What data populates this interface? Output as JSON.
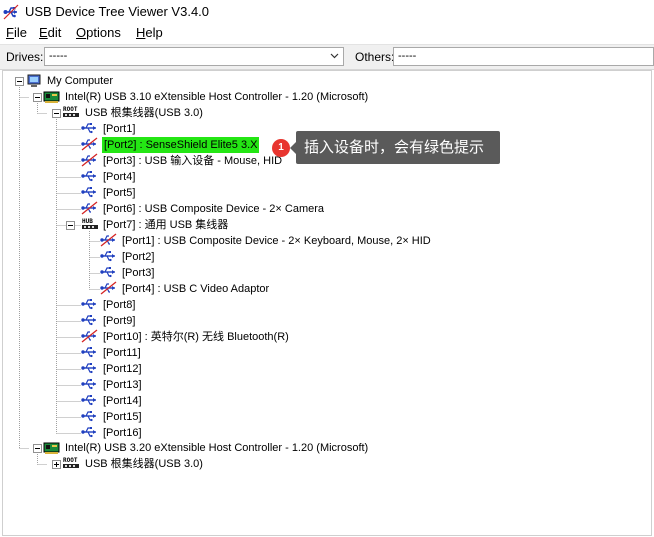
{
  "window": {
    "title": "USB Device Tree Viewer V3.4.0"
  },
  "menu": {
    "items": [
      {
        "key": "F",
        "rest": "ile"
      },
      {
        "key": "E",
        "rest": "dit"
      },
      {
        "key": "O",
        "rest": "ptions"
      },
      {
        "key": "H",
        "rest": "elp"
      }
    ]
  },
  "toolbar": {
    "drives_label": "Drives:",
    "drives_value": "-----",
    "others_label": "Others:",
    "others_value": "-----"
  },
  "tree": {
    "root": "My Computer",
    "controller1": "Intel(R) USB 3.10 eXtensible Host Controller - 1.20 (Microsoft)",
    "roothub1_badge": "ROOT",
    "roothub1": "USB 根集线器(USB 3.0)",
    "ports": [
      "[Port1]",
      "[Port2] : SenseShield Elite5 3.X",
      "[Port3] : USB 输入设备 - Mouse, HID",
      "[Port4]",
      "[Port5]",
      "[Port6] : USB Composite Device - 2× Camera",
      "[Port7] : 通用 USB 集线器"
    ],
    "hub_badge": "HUB",
    "subports": [
      "[Port1] : USB Composite Device - 2× Keyboard, Mouse, 2× HID",
      "[Port2]",
      "[Port3]",
      "[Port4] : USB C Video Adaptor"
    ],
    "ports_after": [
      "[Port8]",
      "[Port9]",
      "[Port10] : 英特尔(R) 无线 Bluetooth(R)",
      "[Port11]",
      "[Port12]",
      "[Port13]",
      "[Port14]",
      "[Port15]",
      "[Port16]"
    ],
    "controller2": "Intel(R) USB 3.20 eXtensible Host Controller - 1.20 (Microsoft)",
    "roothub2_badge": "ROOT",
    "roothub2": "USB 根集线器(USB 3.0)"
  },
  "callout": {
    "badge": "1",
    "text": "插入设备时，会有绿色提示"
  },
  "colors": {
    "highlight": "#24e614",
    "callout_bg": "#5a5a5a",
    "badge_bg": "#e8352f"
  }
}
